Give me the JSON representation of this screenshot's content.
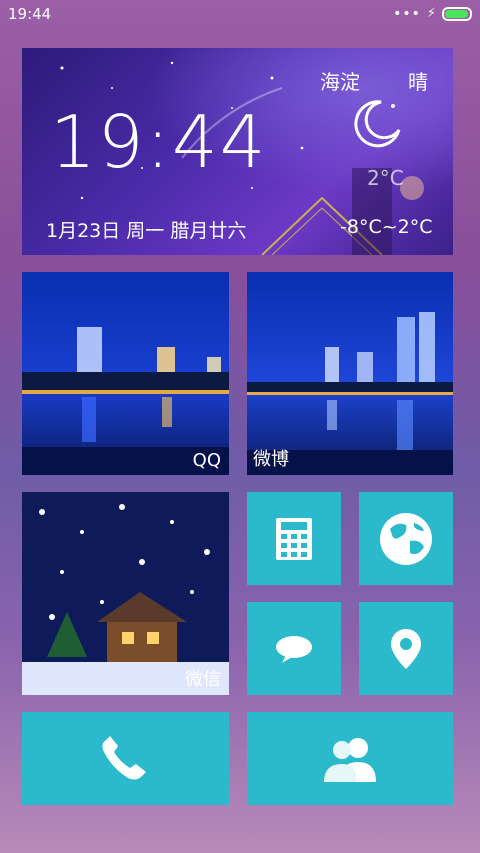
{
  "status": {
    "time": "19:44",
    "dots": "•••",
    "battery_level": 0.95
  },
  "weather": {
    "city": "海淀",
    "condition": "晴",
    "time": "19:44",
    "current_temp": "2°C",
    "date": "1月23日 周一 腊月廿六",
    "range": "-8°C~2°C"
  },
  "tiles": {
    "qq_label": "QQ",
    "weibo_label": "微博",
    "wechat_label": "微信"
  },
  "colors": {
    "tile": "#2bb9cc"
  }
}
